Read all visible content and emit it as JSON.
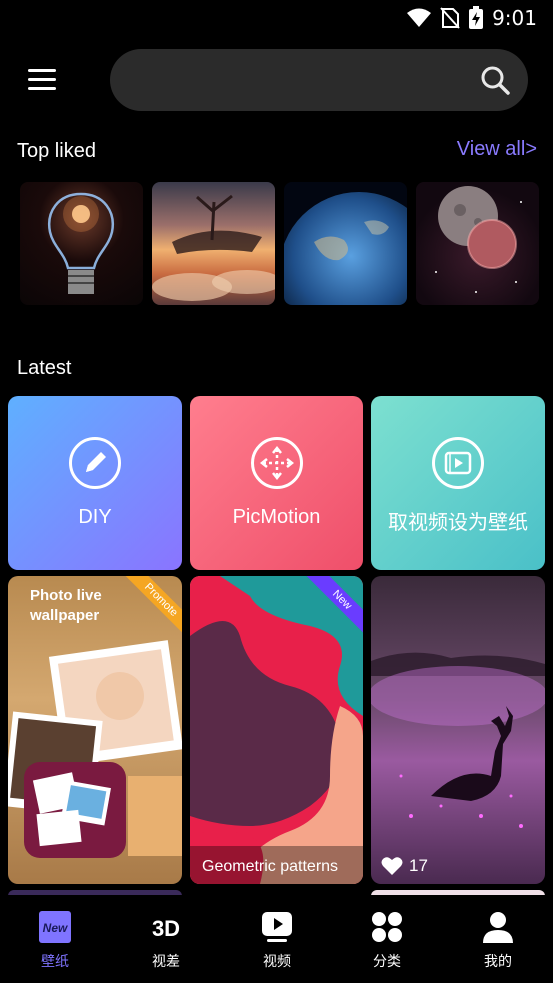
{
  "status": {
    "time": "9:01"
  },
  "search": {
    "placeholder": ""
  },
  "top_liked": {
    "title": "Top liked",
    "view_all": "View all>"
  },
  "latest": {
    "title": "Latest"
  },
  "features": [
    {
      "label": "DIY"
    },
    {
      "label": "PicMotion"
    },
    {
      "label": "取视频设为壁纸"
    }
  ],
  "cards": {
    "photo_live": {
      "title_line1": "Photo live",
      "title_line2": "wallpaper",
      "ribbon": "Promote"
    },
    "geometric": {
      "ribbon": "New",
      "caption": "Geometric patterns"
    },
    "deer": {
      "likes": "17"
    }
  },
  "tabs": [
    {
      "label": "壁纸",
      "active": true
    },
    {
      "label": "视差",
      "icon_text": "3D"
    },
    {
      "label": "视频"
    },
    {
      "label": "分类"
    },
    {
      "label": "我的"
    }
  ],
  "colors": {
    "accent": "#7f74ff",
    "link": "#8a7bff"
  }
}
